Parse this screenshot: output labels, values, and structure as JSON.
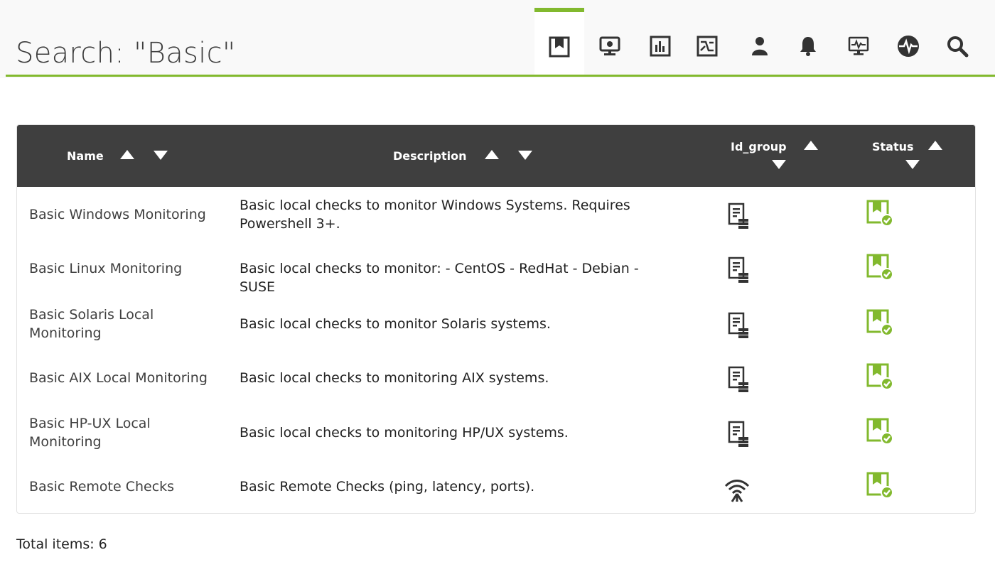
{
  "page": {
    "title": "Search: \"Basic\""
  },
  "header_tabs": [
    {
      "icon": "policies-icon",
      "active": true
    },
    {
      "icon": "agents-icon"
    },
    {
      "icon": "reports-icon"
    },
    {
      "icon": "graphs-icon"
    },
    {
      "icon": "users-icon"
    },
    {
      "icon": "alerts-icon"
    },
    {
      "icon": "monitors-icon"
    },
    {
      "icon": "modules-icon"
    },
    {
      "icon": "search-icon"
    }
  ],
  "table": {
    "columns": [
      {
        "key": "name",
        "label": "Name"
      },
      {
        "key": "description",
        "label": "Description"
      },
      {
        "key": "id_group",
        "label": "Id_group"
      },
      {
        "key": "status",
        "label": "Status"
      }
    ],
    "rows": [
      {
        "name": "Basic Windows Monitoring",
        "description": "Basic local checks to monitor Windows Systems. Requires Powershell 3+.",
        "group_icon": "servers-icon",
        "status_icon": "policy-ok-icon"
      },
      {
        "name": "Basic Linux Monitoring",
        "description": "Basic local checks to monitor: - CentOS - RedHat - Debian - SUSE",
        "group_icon": "servers-icon",
        "status_icon": "policy-ok-icon"
      },
      {
        "name": "Basic Solaris Local Monitoring",
        "description": "Basic local checks to monitor Solaris systems.",
        "group_icon": "servers-icon",
        "status_icon": "policy-ok-icon"
      },
      {
        "name": "Basic AIX Local Monitoring",
        "description": "Basic local checks to monitoring AIX systems.",
        "group_icon": "servers-icon",
        "status_icon": "policy-ok-icon"
      },
      {
        "name": "Basic HP-UX Local Monitoring",
        "description": "Basic local checks to monitoring HP/UX systems.",
        "group_icon": "servers-icon",
        "status_icon": "policy-ok-icon"
      },
      {
        "name": "Basic Remote Checks",
        "description": "Basic Remote Checks (ping, latency, ports).",
        "group_icon": "wifi-icon",
        "status_icon": "policy-ok-icon"
      }
    ]
  },
  "footer": {
    "total": "Total items: 6"
  },
  "colors": {
    "accent": "#82b92e",
    "header_bg": "#3f3f3f",
    "icon_dark": "#333333"
  }
}
